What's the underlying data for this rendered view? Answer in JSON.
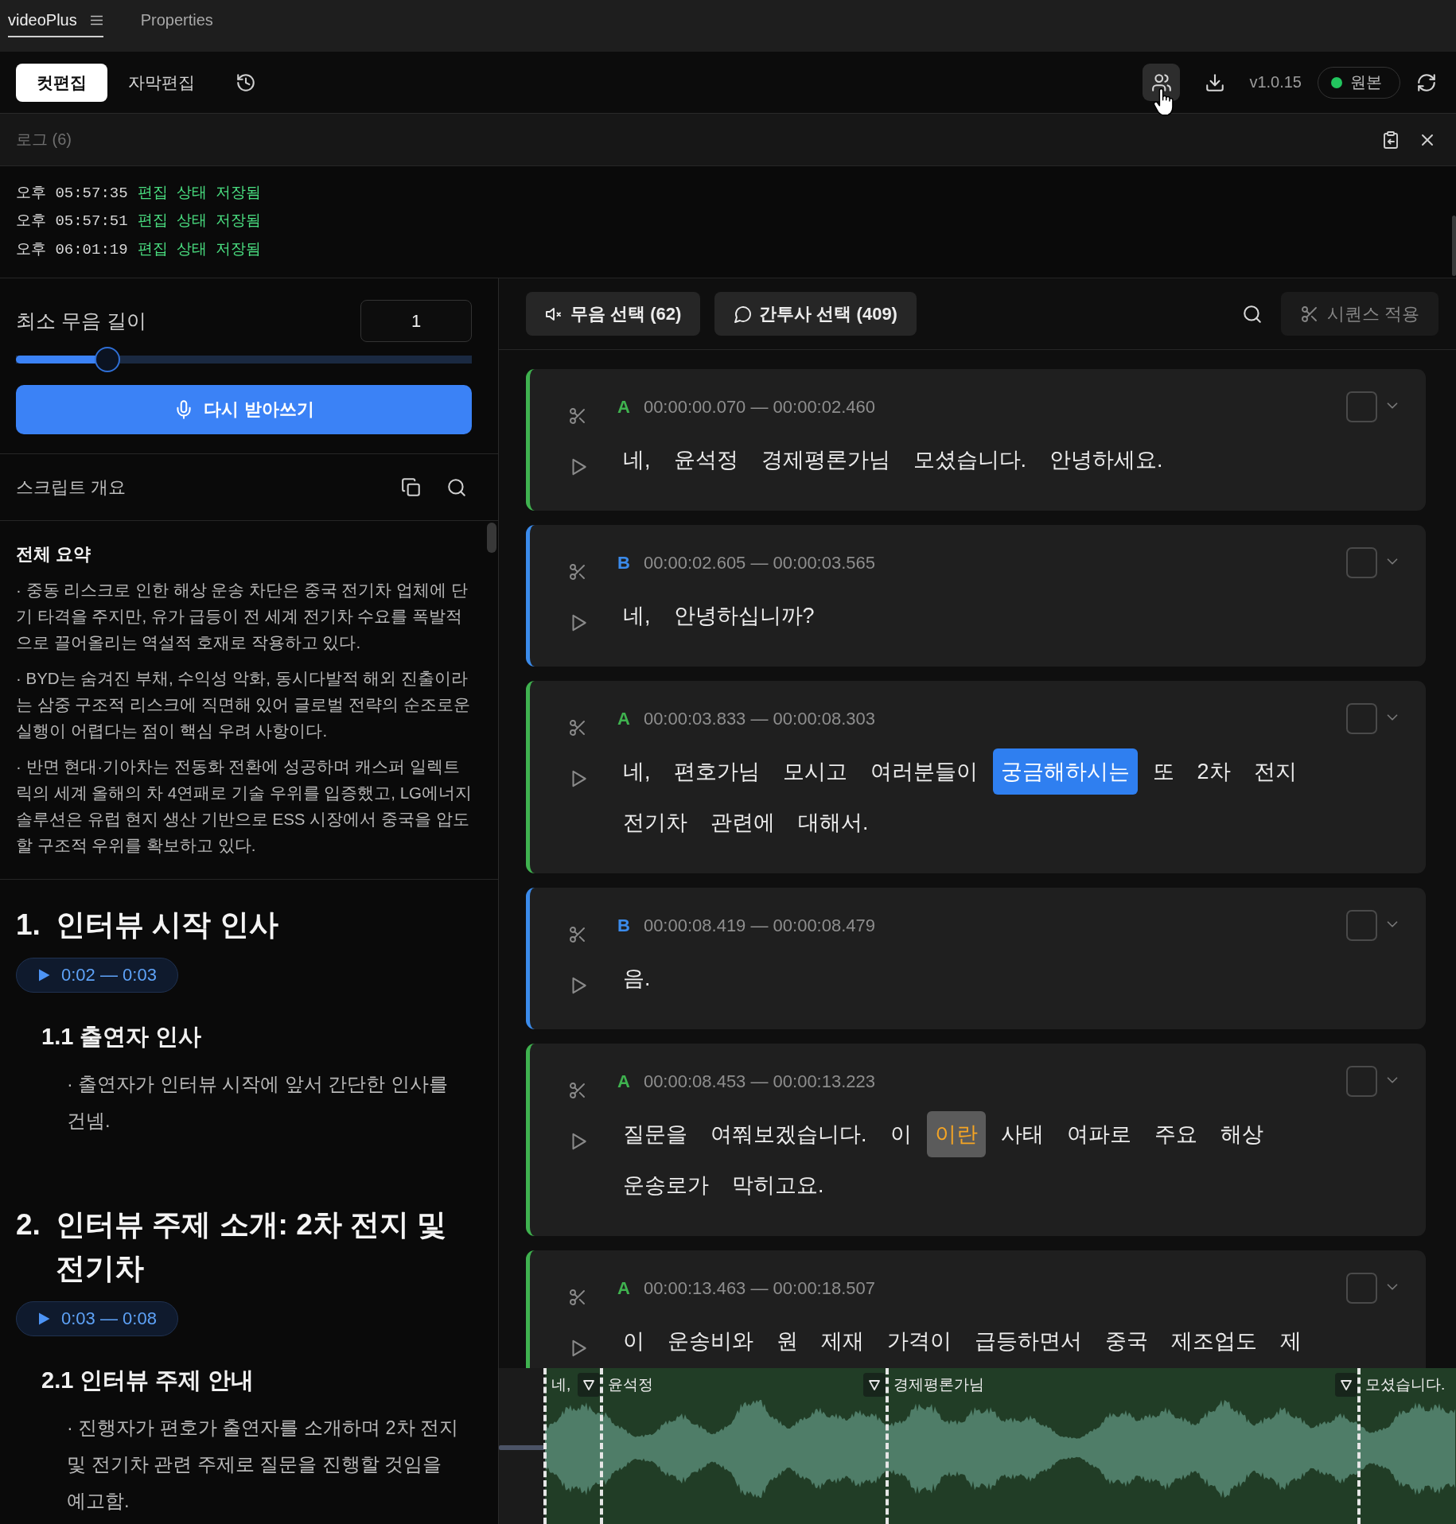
{
  "tabs": [
    {
      "label": "videoPlus",
      "selected": true,
      "menu_icon": true
    },
    {
      "label": "Properties",
      "selected": false,
      "menu_icon": false
    }
  ],
  "toolbar": {
    "modes": [
      {
        "label": "컷편집",
        "selected": true
      },
      {
        "label": "자막편집",
        "selected": false
      }
    ],
    "actions": [
      {
        "kind": "users",
        "highlighted": true
      },
      {
        "kind": "download",
        "highlighted": false
      }
    ],
    "version": "v1.0.15",
    "source": {
      "label": "원본",
      "color": "#22c55e"
    }
  },
  "log": {
    "title": "로그 (6)",
    "entries": [
      {
        "time": "오후 05:57:35",
        "message": "편집 상태 저장됨"
      },
      {
        "time": "오후 05:57:51",
        "message": "편집 상태 저장됨"
      },
      {
        "time": "오후 06:01:19",
        "message": "편집 상태 저장됨"
      }
    ]
  },
  "silence": {
    "label": "최소 무음 길이",
    "value": "1",
    "level": 0.2,
    "button": "다시 받아쓰기"
  },
  "overview": {
    "title": "스크립트 개요",
    "summary": {
      "title": "전체 요약",
      "points": [
        "· 중동 리스크로 인한 해상 운송 차단은 중국 전기차 업체에 단기 타격을 주지만, 유가 급등이 전 세계 전기차 수요를 폭발적으로 끌어올리는 역설적 호재로 작용하고 있다.",
        "· BYD는 숨겨진 부채, 수익성 악화, 동시다발적 해외 진출이라는 삼중 구조적 리스크에 직면해 있어 글로벌 전략의 순조로운 실행이 어렵다는 점이 핵심 우려 사항이다.",
        "· 반면 현대·기아차는 전동화 전환에 성공하며 캐스퍼 일렉트릭의 세계 올해의 차 4연패로 기술 우위를 입증했고, LG에너지솔루션은 유럽 현지 생산 기반으로 ESS 시장에서 중국을 압도할 구조적 우위를 확보하고 있다."
      ]
    },
    "sections": [
      {
        "number": "1.",
        "title": "인터뷰 시작 인사",
        "time": "0:02 — 0:03",
        "subsections": [
          {
            "title": "1.1 출연자 인사",
            "points": [
              "· 출연자가 인터뷰 시작에 앞서 간단한 인사를 건넴."
            ]
          }
        ]
      },
      {
        "number": "2.",
        "title": "인터뷰 주제 소개: 2차 전지 및 전기차",
        "time": "0:03 — 0:08",
        "subsections": [
          {
            "title": "2.1 인터뷰 주제 안내",
            "points": [
              "· 진행자가 편호가 출연자를 소개하며 2차 전지 및 전기차 관련 주제로 질문을 진행할 것임을 예고함."
            ]
          }
        ]
      }
    ]
  },
  "selection_bar": {
    "buttons": [
      {
        "kind": "silence",
        "label": "무음 선택 (62)"
      },
      {
        "kind": "filler",
        "label": "간투사 선택 (409)"
      }
    ],
    "apply": {
      "label": "시퀀스 적용",
      "disabled": true
    }
  },
  "segments": [
    {
      "speaker": "A",
      "color": "#3fb24f",
      "time": "00:00:00.070 — 00:00:02.460",
      "checked": false,
      "words": [
        {
          "text": "네,",
          "kind": "plain"
        },
        {
          "text": "윤석정",
          "kind": "plain"
        },
        {
          "text": "경제평론가님",
          "kind": "plain"
        },
        {
          "text": "모셨습니다.",
          "kind": "plain"
        },
        {
          "text": "안녕하세요.",
          "kind": "plain"
        }
      ]
    },
    {
      "speaker": "B",
      "color": "#3b8beb",
      "time": "00:00:02.605 — 00:00:03.565",
      "checked": false,
      "words": [
        {
          "text": "네,",
          "kind": "plain"
        },
        {
          "text": "안녕하십니까?",
          "kind": "plain"
        }
      ]
    },
    {
      "speaker": "A",
      "color": "#3fb24f",
      "time": "00:00:03.833 — 00:00:08.303",
      "checked": false,
      "words": [
        {
          "text": "네,",
          "kind": "plain"
        },
        {
          "text": "편호가님",
          "kind": "plain"
        },
        {
          "text": "모시고",
          "kind": "plain"
        },
        {
          "text": "여러분들이",
          "kind": "plain"
        },
        {
          "text": "궁금해하시는",
          "kind": "active"
        },
        {
          "text": "또",
          "kind": "plain"
        },
        {
          "text": "2차",
          "kind": "plain"
        },
        {
          "text": "전지",
          "kind": "plain"
        },
        {
          "text": "전기차",
          "kind": "plain"
        },
        {
          "text": "관련에",
          "kind": "plain"
        },
        {
          "text": "대해서.",
          "kind": "plain"
        }
      ]
    },
    {
      "speaker": "B",
      "color": "#3b8beb",
      "time": "00:00:08.419 — 00:00:08.479",
      "checked": false,
      "words": [
        {
          "text": "음.",
          "kind": "plain"
        }
      ]
    },
    {
      "speaker": "A",
      "color": "#3fb24f",
      "time": "00:00:08.453 — 00:00:13.223",
      "checked": false,
      "words": [
        {
          "text": "질문을",
          "kind": "plain"
        },
        {
          "text": "여쭤보겠습니다.",
          "kind": "plain"
        },
        {
          "text": "이",
          "kind": "plain"
        },
        {
          "text": "이란",
          "kind": "filler"
        },
        {
          "text": "사태",
          "kind": "plain"
        },
        {
          "text": "여파로",
          "kind": "plain"
        },
        {
          "text": "주요",
          "kind": "plain"
        },
        {
          "text": "해상",
          "kind": "plain"
        },
        {
          "text": "운송로가",
          "kind": "plain"
        },
        {
          "text": "막히고요.",
          "kind": "plain"
        }
      ]
    },
    {
      "speaker": "A",
      "color": "#3fb24f",
      "time": "00:00:13.463 — 00:00:18.507",
      "checked": false,
      "words": [
        {
          "text": "이",
          "kind": "plain"
        },
        {
          "text": "운송비와",
          "kind": "plain"
        },
        {
          "text": "원",
          "kind": "plain"
        },
        {
          "text": "제재",
          "kind": "plain"
        },
        {
          "text": "가격이",
          "kind": "plain"
        },
        {
          "text": "급등하면서",
          "kind": "plain"
        },
        {
          "text": "중국",
          "kind": "plain"
        },
        {
          "text": "제조업도",
          "kind": "plain"
        },
        {
          "text": "제",
          "kind": "plain"
        }
      ]
    }
  ],
  "waveform": {
    "labels": [
      "네,",
      "윤석정",
      "경제평론가님",
      "모셨습니다."
    ]
  }
}
